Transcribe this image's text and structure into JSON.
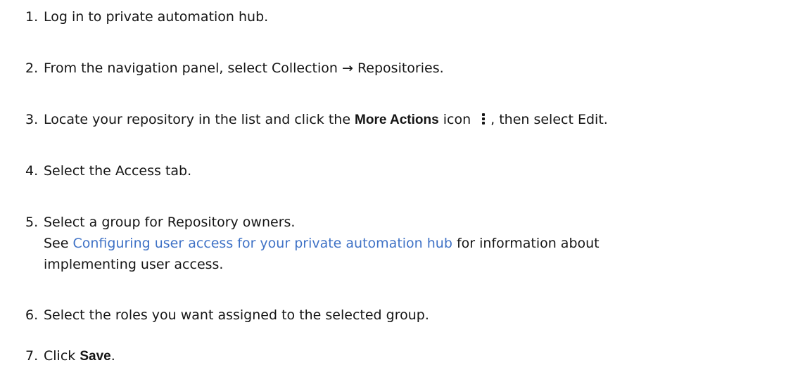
{
  "steps": [
    {
      "number": "1.",
      "text": "Log in to private automation hub."
    },
    {
      "number": "2.",
      "pre": "From the navigation panel, select ",
      "menu_path": "Collection → Repositories",
      "post": "."
    },
    {
      "number": "3.",
      "pre": "Locate your repository in the list and click the ",
      "more_actions": "More Actions",
      "mid": " icon",
      "post": ", then select ",
      "edit": "Edit",
      "end": "."
    },
    {
      "number": "4.",
      "pre": "Select the ",
      "access": "Access",
      "post": " tab."
    },
    {
      "number": "5.",
      "pre": "Select a group for ",
      "owners": "Repository owners",
      "post": ".",
      "line2_pre": "See ",
      "link": "Configuring user access for your private automation hub",
      "line2_post": " for information about",
      "line3": "implementing user access."
    },
    {
      "number": "6.",
      "text": "Select the roles you want assigned to the selected group."
    },
    {
      "number": "7.",
      "pre": "Click ",
      "save": "Save",
      "post": "."
    }
  ],
  "icons": {
    "more_actions": "kebab-vertical-icon"
  },
  "colors": {
    "text": "#151515",
    "link": "#3f72c6"
  }
}
